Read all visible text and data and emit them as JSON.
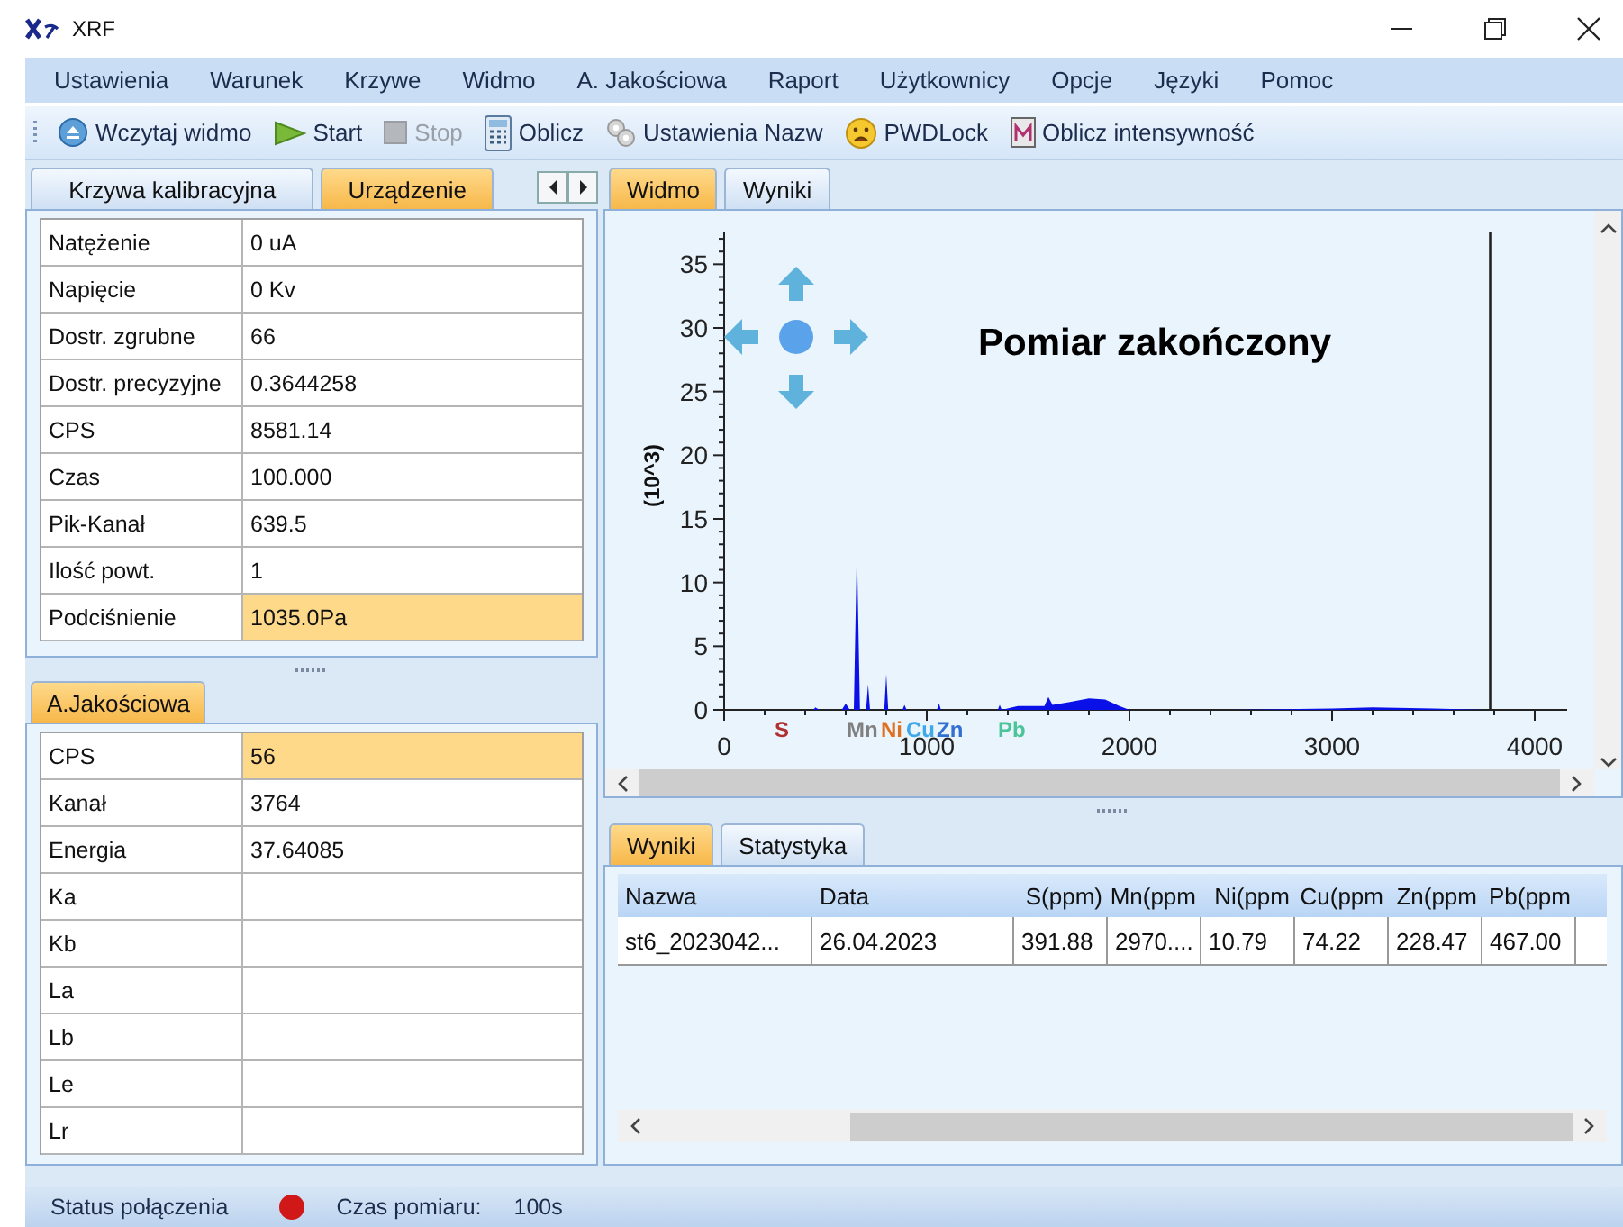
{
  "window": {
    "title": "XRF"
  },
  "menu": [
    "Ustawienia",
    "Warunek",
    "Krzywe",
    "Widmo",
    "A. Jakościowa",
    "Raport",
    "Użytkownicy",
    "Opcje",
    "Języki",
    "Pomoc"
  ],
  "toolbar": [
    {
      "label": "Wczytaj widmo",
      "kind": "eject",
      "disabled": false
    },
    {
      "label": "Start",
      "kind": "play",
      "disabled": false
    },
    {
      "label": "Stop",
      "kind": "stop",
      "disabled": true
    },
    {
      "label": "Oblicz",
      "kind": "calculator",
      "disabled": false
    },
    {
      "label": "Ustawienia Nazw",
      "kind": "gears",
      "disabled": false
    },
    {
      "label": "PWDLock",
      "kind": "face",
      "disabled": false
    },
    {
      "label": "Oblicz intensywność",
      "kind": "document",
      "disabled": false
    }
  ],
  "left_tabs": [
    {
      "label": "Krzywa kalibracyjna",
      "selected": false
    },
    {
      "label": "Urządzenie",
      "selected": true
    }
  ],
  "device_table": {
    "rows": [
      {
        "label": "Natężenie",
        "value": "0 uA",
        "selected": false
      },
      {
        "label": "Napięcie",
        "value": "0 Kv",
        "selected": false
      },
      {
        "label": "Dostr. zgrubne",
        "value": "66",
        "selected": false
      },
      {
        "label": "Dostr. precyzyjne",
        "value": "0.3644258",
        "selected": false
      },
      {
        "label": "CPS",
        "value": "8581.14",
        "selected": false
      },
      {
        "label": "Czas",
        "value": "100.000",
        "selected": false
      },
      {
        "label": "Pik-Kanał",
        "value": "639.5",
        "selected": false
      },
      {
        "label": "Ilość powt.",
        "value": "1",
        "selected": false
      },
      {
        "label": "Podciśnienie",
        "value": "1035.0Pa",
        "selected": true
      }
    ]
  },
  "quality_panel": {
    "tab": "A.Jakościowa",
    "rows": [
      {
        "label": "CPS",
        "value": "56",
        "selected": true
      },
      {
        "label": "Kanał",
        "value": "3764",
        "selected": false
      },
      {
        "label": "Energia",
        "value": "37.64085",
        "selected": false
      },
      {
        "label": "Ka",
        "value": "",
        "selected": false
      },
      {
        "label": "Kb",
        "value": "",
        "selected": false
      },
      {
        "label": "La",
        "value": "",
        "selected": false
      },
      {
        "label": "Lb",
        "value": "",
        "selected": false
      },
      {
        "label": "Le",
        "value": "",
        "selected": false
      },
      {
        "label": "Lr",
        "value": "",
        "selected": false
      }
    ]
  },
  "right_tabs": [
    {
      "label": "Widmo",
      "selected": true
    },
    {
      "label": "Wyniki",
      "selected": false
    }
  ],
  "spectrum": {
    "status_text": "Pomiar zakończony",
    "element_labels": [
      {
        "label": "S",
        "color": "#b03030"
      },
      {
        "label": "Mn",
        "color": "#808080"
      },
      {
        "label": "Ni",
        "color": "#e07020"
      },
      {
        "label": "Cu",
        "color": "#40a8e8"
      },
      {
        "label": "Zn",
        "color": "#3070d0"
      },
      {
        "label": "Pb",
        "color": "#4cc49a"
      }
    ],
    "chart_data": {
      "type": "area",
      "ylabel": "(10^3)",
      "xlim": [
        0,
        4160
      ],
      "ylim": [
        0,
        37.5
      ],
      "xticks": [
        0,
        1000,
        2000,
        3000,
        4000
      ],
      "yticks": [
        0,
        5,
        10,
        15,
        20,
        25,
        30,
        35
      ],
      "x": [
        0,
        440,
        450,
        470,
        580,
        600,
        620,
        640,
        655,
        670,
        700,
        710,
        720,
        790,
        800,
        810,
        880,
        890,
        900,
        1050,
        1060,
        1070,
        1350,
        1360,
        1370,
        1450,
        1580,
        1600,
        1620,
        1700,
        1800,
        1880,
        1950,
        2000,
        2500,
        3000,
        3200,
        3500,
        3760,
        4000
      ],
      "series": [
        {
          "color": "#0a10e8",
          "values": [
            0,
            0,
            0.2,
            0,
            0,
            0.5,
            0,
            0,
            12.7,
            0,
            0,
            2,
            0,
            0,
            2.8,
            0,
            0,
            0.4,
            0,
            0,
            0.5,
            0,
            0,
            0.4,
            0,
            0.3,
            0.3,
            1,
            0.4,
            0.6,
            0.9,
            0.8,
            0.3,
            0,
            0,
            0.1,
            0.2,
            0.1,
            0,
            0
          ]
        }
      ],
      "ref_lines": [
        {
          "axis": "x",
          "value": 3780
        }
      ]
    }
  },
  "results_tabs": [
    {
      "label": "Wyniki",
      "selected": true
    },
    {
      "label": "Statystyka",
      "selected": false
    }
  ],
  "results_table": {
    "columns": [
      "Nazwa",
      "Data",
      "S(ppm)",
      "Mn(ppm",
      "Ni(ppm",
      "Cu(ppm",
      "Zn(ppm",
      "Pb(ppm"
    ],
    "rows": [
      [
        "st6_2023042...",
        "26.04.2023",
        "391.88",
        "2970....",
        "10.79",
        "74.22",
        "228.47",
        "467.00"
      ]
    ]
  },
  "status_bar": {
    "connection_label": "Status połączenia",
    "connected": false,
    "time_label": "Czas pomiaru:",
    "time_value": "100s"
  }
}
